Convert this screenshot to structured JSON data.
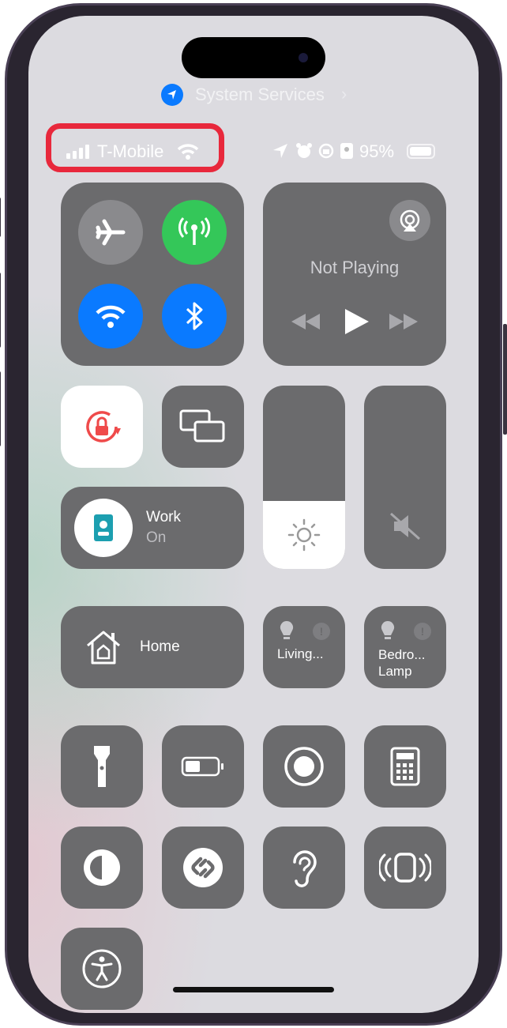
{
  "location_banner": {
    "label": "System Services",
    "icon": "location-arrow-icon"
  },
  "status_bar": {
    "carrier": "T-Mobile",
    "battery": "95%",
    "battery_level": 0.95,
    "icons": [
      "signal-icon",
      "wifi-icon",
      "location-icon",
      "alarm-icon",
      "orientation-lock-icon",
      "focus-work-icon",
      "battery-icon"
    ]
  },
  "highlight_color": "#e8283c",
  "connectivity": {
    "airplane": false,
    "cellular": true,
    "wifi": true,
    "bluetooth": true
  },
  "media": {
    "status": "Not Playing"
  },
  "focus": {
    "label": "Work",
    "state": "On"
  },
  "brightness_level": 0.37,
  "home": {
    "label": "Home"
  },
  "accessories": [
    {
      "label": "Living..."
    },
    {
      "label": "Bedro...",
      "label2": "Lamp"
    }
  ],
  "colors": {
    "accent_blue": "#0a7aff",
    "green": "#34c759",
    "tile": "#6b6b6d",
    "lock_red": "#ef4a4a"
  }
}
